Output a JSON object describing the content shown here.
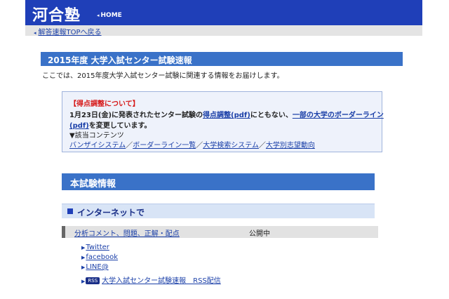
{
  "header": {
    "logo": "河合塾",
    "home_label": "HOME",
    "home_arrow": "◂"
  },
  "subnav": {
    "back_label": "解答速報TOPへ戻る",
    "back_arrow": "◂"
  },
  "page": {
    "title": "2015年度 大学入試センター試験速報",
    "intro": "ここでは、2015年度大学入試センター試験に関連する情報をお届けします。"
  },
  "notice": {
    "heading": "【得点調整について】",
    "line1_pre": "1月23日(金)に発表されたセンター試験の",
    "line1_link1": "得点調整(pdf)",
    "line1_mid": "にともない、",
    "line1_link2": "一部の大学のボーダーライン",
    "line2_link": "(pdf)",
    "line2_post": "を変更しています。",
    "contents_label": "▼該当コンテンツ",
    "links": [
      "バンザイシステム",
      "ボーダーライン一覧",
      "大学検索システム",
      "大学別志望動向"
    ],
    "separator": "／"
  },
  "section": {
    "title": "本試験情報"
  },
  "subsection": {
    "title": "インターネットで"
  },
  "row": {
    "link": "分析コメント、問題、正解・配点",
    "status": "公開中"
  },
  "social": {
    "arrow": "▶",
    "items": [
      "Twitter",
      "facebook",
      "LINE@"
    ],
    "rss_badge": "RSS",
    "rss_label": "大学入試センター試験速報　RSS配信"
  }
}
